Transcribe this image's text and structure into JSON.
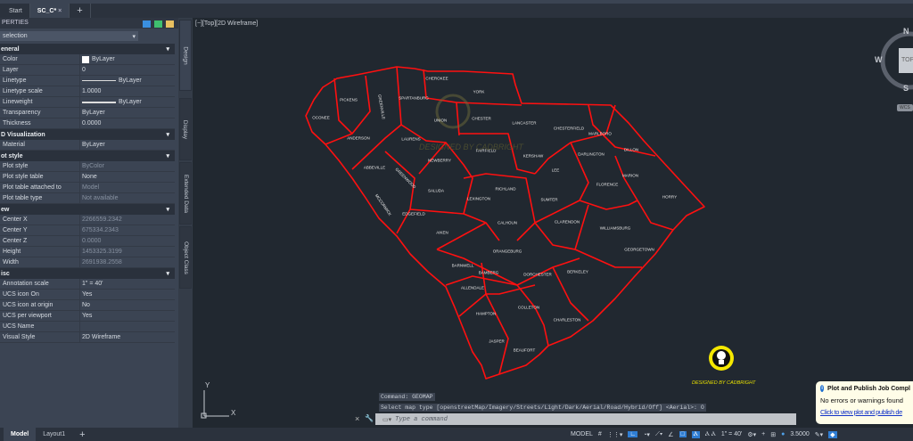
{
  "tabs": [
    {
      "label": "Start"
    },
    {
      "label": "SC_C*"
    }
  ],
  "new_tab": "+",
  "properties": {
    "title": "PERTIES",
    "selection": "selection",
    "sections": [
      {
        "name": "eneral",
        "rows": [
          {
            "k": "Color",
            "v": "ByLayer",
            "swatch": "#ffffff"
          },
          {
            "k": "Layer",
            "v": "0"
          },
          {
            "k": "Linetype",
            "v": "ByLayer",
            "line": "thin"
          },
          {
            "k": "Linetype scale",
            "v": "1.0000"
          },
          {
            "k": "Lineweight",
            "v": "ByLayer",
            "line": "thick"
          },
          {
            "k": "Transparency",
            "v": "ByLayer"
          },
          {
            "k": "Thickness",
            "v": "0.0000"
          }
        ]
      },
      {
        "name": "D Visualization",
        "rows": [
          {
            "k": "Material",
            "v": "ByLayer"
          }
        ]
      },
      {
        "name": "ot style",
        "rows": [
          {
            "k": "Plot style",
            "v": "ByColor",
            "dim": true
          },
          {
            "k": "Plot style table",
            "v": "None"
          },
          {
            "k": "Plot table attached to",
            "v": "Model",
            "dim": true
          },
          {
            "k": "Plot table type",
            "v": "Not available",
            "dim": true
          }
        ]
      },
      {
        "name": "ew",
        "rows": [
          {
            "k": "Center X",
            "v": "2266559.2342",
            "dim": true
          },
          {
            "k": "Center Y",
            "v": "675334.2343",
            "dim": true
          },
          {
            "k": "Center Z",
            "v": "0.0000",
            "dim": true
          },
          {
            "k": "Height",
            "v": "1453325.3199",
            "dim": true
          },
          {
            "k": "Width",
            "v": "2691938.2558",
            "dim": true
          }
        ]
      },
      {
        "name": "isc",
        "rows": [
          {
            "k": "Annotation scale",
            "v": "1\" = 40'"
          },
          {
            "k": "UCS icon On",
            "v": "Yes"
          },
          {
            "k": "UCS icon at origin",
            "v": "No"
          },
          {
            "k": "UCS per viewport",
            "v": "Yes"
          },
          {
            "k": "UCS Name",
            "v": ""
          },
          {
            "k": "Visual Style",
            "v": "2D Wireframe"
          }
        ]
      }
    ]
  },
  "side_tabs": [
    "Design",
    "Display",
    "Extended Data",
    "Object Class"
  ],
  "viewport": {
    "label": "[−][Top][2D Wireframe]",
    "watermark": "DESIGNED BY CADBRIGHT",
    "boundary_color": "#ff0000"
  },
  "counties": [
    "CHEROKEE",
    "YORK",
    "SPARTANBURG",
    "UNION",
    "CHESTER",
    "PICKENS",
    "GREENVILLE",
    "OCONEE",
    "ANDERSON",
    "LAURENS",
    "NEWBERRY",
    "FAIRFIELD",
    "LANCASTER",
    "CHESTERFIELD",
    "MARLBORO",
    "DILLON",
    "KERSHAW",
    "DARLINGTON",
    "LEE",
    "MARION",
    "FLORENCE",
    "HORRY",
    "ABBEVILLE",
    "GREENWOOD",
    "MCCORMICK",
    "SALUDA",
    "LEXINGTON",
    "RICHLAND",
    "SUMTER",
    "CALHOUN",
    "CLARENDON",
    "WILLIAMSBURG",
    "GEORGETOWN",
    "EDGEFIELD",
    "AIKEN",
    "ORANGEBURG",
    "BARNWELL",
    "BAMBERG",
    "DORCHESTER",
    "BERKELEY",
    "ALLENDALE",
    "HAMPTON",
    "COLLETON",
    "CHARLESTON",
    "JASPER",
    "BEAUFORT"
  ],
  "viewcube": {
    "n": "N",
    "w": "W",
    "s": "S",
    "face": "TOP",
    "wcs": "WCS"
  },
  "ucs": {
    "x": "X",
    "y": "Y"
  },
  "command": {
    "history1": "Command: GEOMAP",
    "history2": "Select map type [openstreetMap/Imagery/Streets/Light/Dark/Aerial/Road/Hybrid/Off] <Aerial>: O",
    "placeholder": "Type a command"
  },
  "layout_tabs": [
    {
      "label": "Model"
    },
    {
      "label": "Layout1"
    }
  ],
  "status": {
    "model": "MODEL",
    "scale": "1\" = 40'",
    "lineweight": "3.5000"
  },
  "notification": {
    "title": "Plot and Publish Job Compl",
    "message": "No errors or warnings found",
    "link": "Click to view plot and publish de"
  }
}
